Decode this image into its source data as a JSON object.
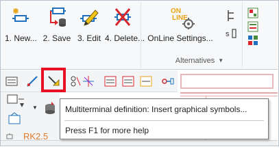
{
  "ribbon": {
    "buttons": [
      {
        "label": "1. New...",
        "icon": "new-icon"
      },
      {
        "label": "2. Save",
        "icon": "save-icon"
      },
      {
        "label": "3. Edit",
        "icon": "edit-icon"
      },
      {
        "label": "4. Delete...",
        "icon": "delete-icon"
      }
    ],
    "online": {
      "icon_text": "ON LINE",
      "label": "OnLine Settings..."
    },
    "group_label": "Alternatives",
    "small_tool_text": "s"
  },
  "toolbar": {
    "icons": [
      "properties-icon",
      "insert-graphical-symbols-icon",
      "multiterminal-icon",
      "symbol-icon",
      "star-symbol-icon",
      "edit-list-icon",
      "edit-list-2-icon",
      "color-edit-icon",
      "connect-icon"
    ],
    "highlighted": "insert-graphical-symbols-icon"
  },
  "document": {
    "label": "RK2.5"
  },
  "tooltip": {
    "title": "Multiterminal definition: Insert graphical symbols...",
    "help": "Press F1 for more help"
  },
  "colors": {
    "highlight": "#e81123",
    "accent_blue": "#1f6fbf",
    "accent_red": "#d9262c",
    "label_orange": "#e07b2a"
  }
}
